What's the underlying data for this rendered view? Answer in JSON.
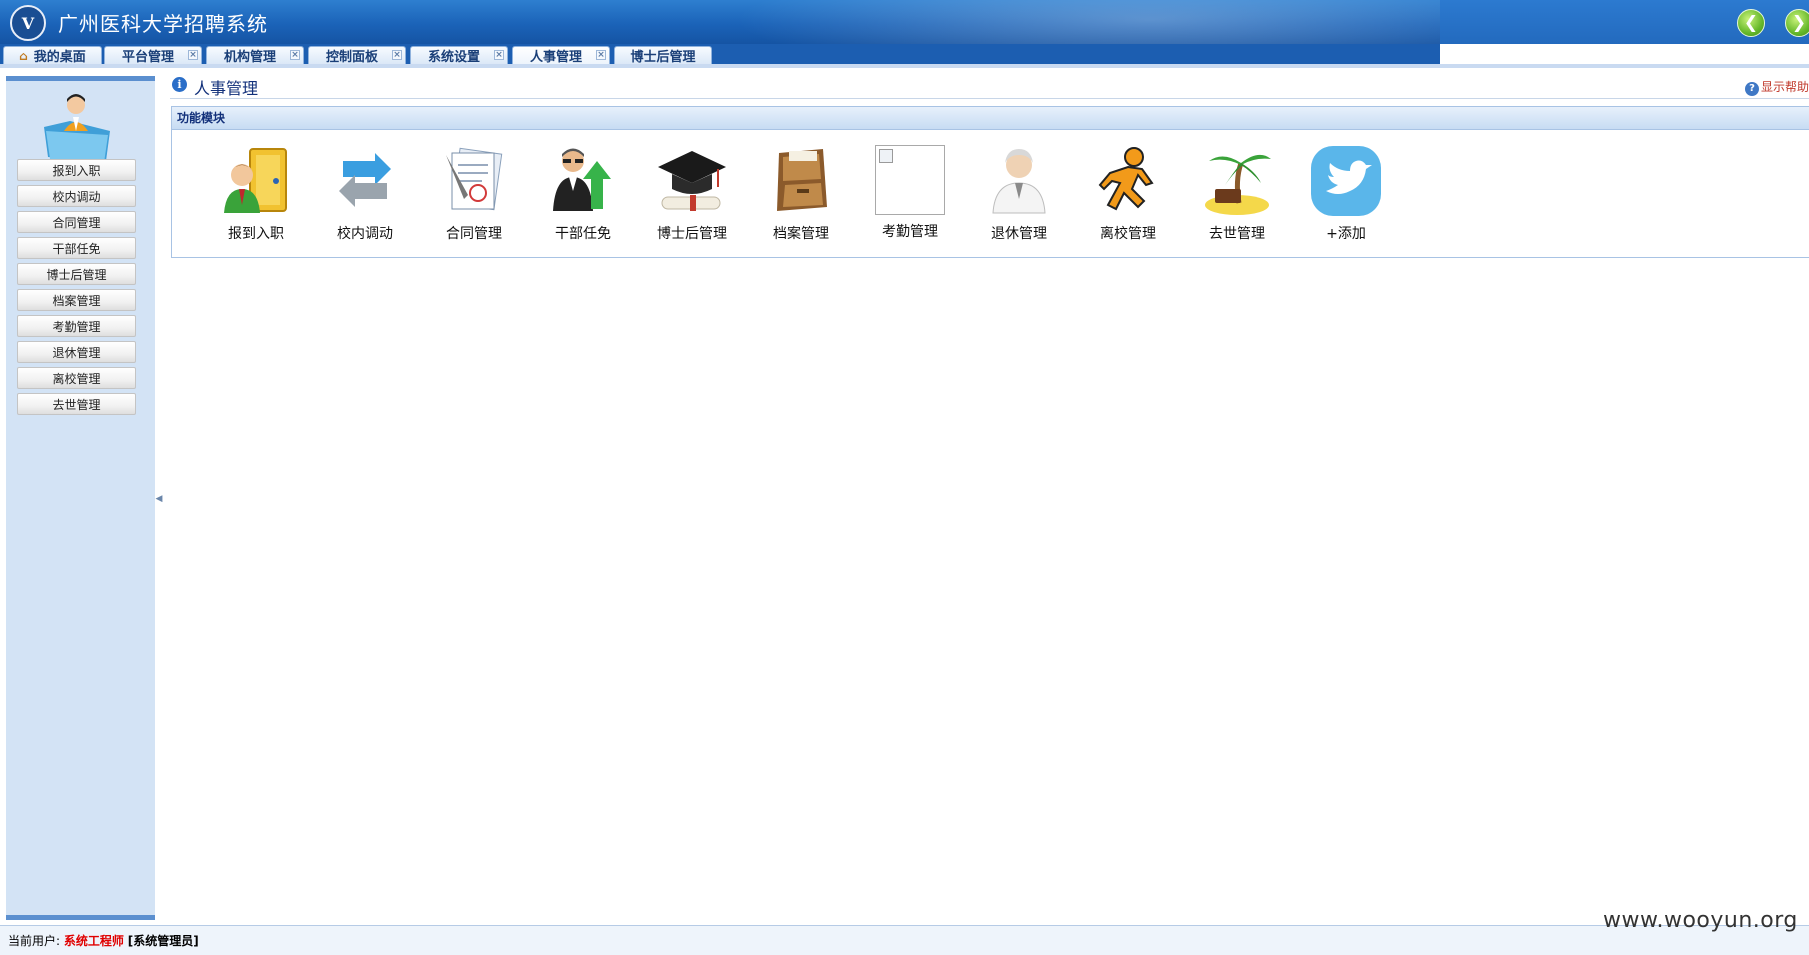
{
  "app": {
    "title": "广州医科大学招聘系统",
    "logo_text": "V"
  },
  "nav": {
    "back_icon": "arrow-left-icon",
    "forward_icon": "arrow-right-icon"
  },
  "tabs": [
    {
      "label": "我的桌面",
      "closable": false,
      "icon": "home-icon"
    },
    {
      "label": "平台管理",
      "closable": true
    },
    {
      "label": "机构管理",
      "closable": true
    },
    {
      "label": "控制面板",
      "closable": true
    },
    {
      "label": "系统设置",
      "closable": true
    },
    {
      "label": "人事管理",
      "closable": true,
      "active": true
    },
    {
      "label": "博士后管理",
      "closable": false
    }
  ],
  "sidebar": {
    "items": [
      "报到入职",
      "校内调动",
      "合同管理",
      "干部任免",
      "博士后管理",
      "档案管理",
      "考勤管理",
      "退休管理",
      "离校管理",
      "去世管理"
    ]
  },
  "main": {
    "title": "人事管理",
    "help": "显示帮助",
    "panel_title": "功能模块",
    "modules": [
      {
        "label": "报到入职",
        "icon": "check-in-door-icon"
      },
      {
        "label": "校内调动",
        "icon": "transfer-arrows-icon"
      },
      {
        "label": "合同管理",
        "icon": "contract-document-icon"
      },
      {
        "label": "干部任免",
        "icon": "promotion-person-icon"
      },
      {
        "label": "博士后管理",
        "icon": "graduation-cap-icon"
      },
      {
        "label": "档案管理",
        "icon": "file-cabinet-icon"
      },
      {
        "label": "考勤管理",
        "icon": "broken-image-icon"
      },
      {
        "label": "退休管理",
        "icon": "elder-doctor-icon"
      },
      {
        "label": "离校管理",
        "icon": "running-man-icon"
      },
      {
        "label": "去世管理",
        "icon": "palm-island-icon"
      },
      {
        "label": "+添加",
        "icon": "bird-icon"
      }
    ]
  },
  "status": {
    "prefix": "当前用户:",
    "user": "系统工程师",
    "role": "[系统管理员]"
  },
  "watermark": "www.wooyun.org",
  "colors": {
    "header": "#1b63b8",
    "sidebar_bg": "#d3e3f5",
    "title_text": "#12307a",
    "user_red": "#e00000"
  }
}
